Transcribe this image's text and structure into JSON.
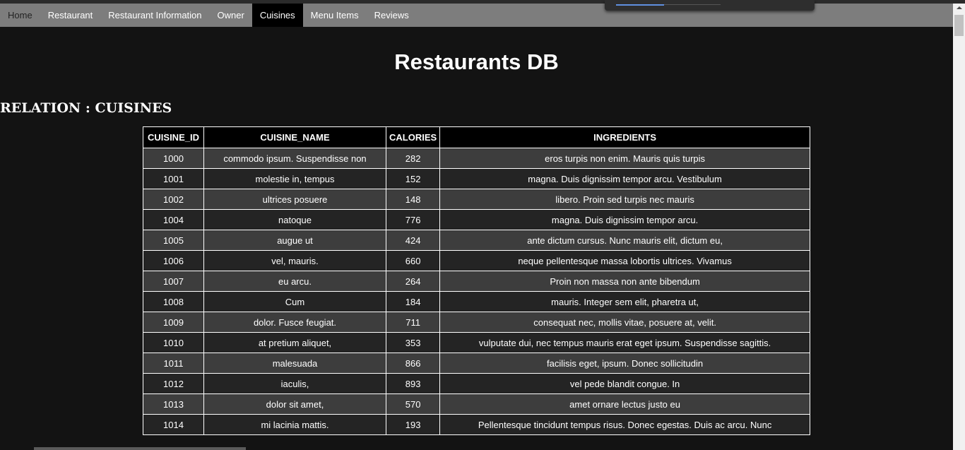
{
  "nav": {
    "items": [
      {
        "label": "Home"
      },
      {
        "label": "Restaurant"
      },
      {
        "label": "Restaurant Information"
      },
      {
        "label": "Owner"
      },
      {
        "label": "Cuisines"
      },
      {
        "label": "Menu Items"
      },
      {
        "label": "Reviews"
      }
    ],
    "active": "Cuisines"
  },
  "page": {
    "title": "Restaurants DB",
    "relation_heading": "RELATION : CUISINES"
  },
  "table": {
    "headers": [
      "CUISINE_ID",
      "CUISINE_NAME",
      "CALORIES",
      "INGREDIENTS"
    ],
    "rows": [
      [
        "1000",
        "commodo ipsum. Suspendisse non",
        "282",
        "eros turpis non enim. Mauris quis turpis"
      ],
      [
        "1001",
        "molestie in, tempus",
        "152",
        "magna. Duis dignissim tempor arcu. Vestibulum"
      ],
      [
        "1002",
        "ultrices posuere",
        "148",
        "libero. Proin sed turpis nec mauris"
      ],
      [
        "1004",
        "natoque",
        "776",
        "magna. Duis dignissim tempor arcu."
      ],
      [
        "1005",
        "augue ut",
        "424",
        "ante dictum cursus. Nunc mauris elit, dictum eu,"
      ],
      [
        "1006",
        "vel, mauris.",
        "660",
        "neque pellentesque massa lobortis ultrices. Vivamus"
      ],
      [
        "1007",
        "eu arcu.",
        "264",
        "Proin non massa non ante bibendum"
      ],
      [
        "1008",
        "Cum",
        "184",
        "mauris. Integer sem elit, pharetra ut,"
      ],
      [
        "1009",
        "dolor. Fusce feugiat.",
        "711",
        "consequat nec, mollis vitae, posuere at, velit."
      ],
      [
        "1010",
        "at pretium aliquet,",
        "353",
        "vulputate dui, nec tempus mauris erat eget ipsum. Suspendisse sagittis."
      ],
      [
        "1011",
        "malesuada",
        "866",
        "facilisis eget, ipsum. Donec sollicitudin"
      ],
      [
        "1012",
        "iaculis,",
        "893",
        "vel pede blandit congue. In"
      ],
      [
        "1013",
        "dolor sit amet,",
        "570",
        "amet ornare lectus justo eu"
      ],
      [
        "1014",
        "mi lacinia mattis.",
        "193",
        "Pellentesque tincidunt tempus risus. Donec egestas. Duis ac arcu. Nunc"
      ]
    ]
  },
  "colors": {
    "nav_bg": "#7d7d7d",
    "nav_active_bg": "#000000",
    "page_bg": "#131313",
    "row_odd": "#3d3d3d",
    "row_even": "#242424"
  }
}
